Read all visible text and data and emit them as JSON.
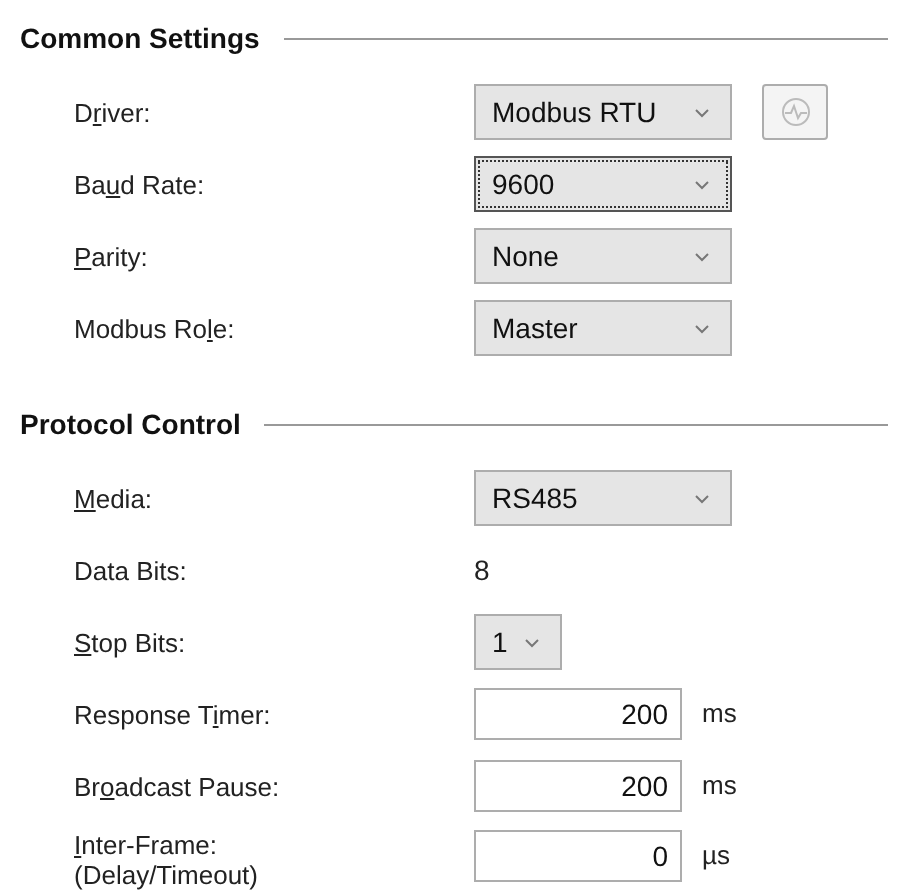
{
  "sections": [
    {
      "title": "Common Settings",
      "rows": [
        {
          "kind": "dropdown",
          "label_before": "D",
          "access_key": "r",
          "label_after": "iver:",
          "value": "Modbus RTU",
          "focused": false,
          "side_button": true
        },
        {
          "kind": "dropdown",
          "label_before": "Ba",
          "access_key": "u",
          "label_after": "d Rate:",
          "value": "9600",
          "focused": true
        },
        {
          "kind": "dropdown",
          "access_key": "P",
          "label_after": "arity:",
          "value": "None",
          "focused": false
        },
        {
          "kind": "dropdown",
          "label_before": "Modbus Ro",
          "access_key": "l",
          "label_after": "e:",
          "value": "Master",
          "focused": false
        }
      ]
    },
    {
      "title": "Protocol Control",
      "rows": [
        {
          "kind": "dropdown",
          "access_key": "M",
          "label_after": "edia:",
          "value": "RS485",
          "focused": false
        },
        {
          "kind": "static",
          "label_after": "Data Bits:",
          "value": "8"
        },
        {
          "kind": "small_dropdown",
          "access_key": "S",
          "label_after": "top Bits:",
          "value": "1",
          "focused": false
        },
        {
          "kind": "number",
          "label_before": "Response T",
          "access_key": "i",
          "label_after": "mer:",
          "value": "200",
          "unit": "ms"
        },
        {
          "kind": "number",
          "label_before": "Br",
          "access_key": "o",
          "label_after": "adcast Pause:",
          "value": "200",
          "unit": "ms"
        },
        {
          "kind": "number",
          "access_key": "I",
          "label_after": "nter-Frame:",
          "label_line2": "(Delay/Timeout)",
          "value": "0",
          "unit": "µs"
        }
      ]
    }
  ]
}
